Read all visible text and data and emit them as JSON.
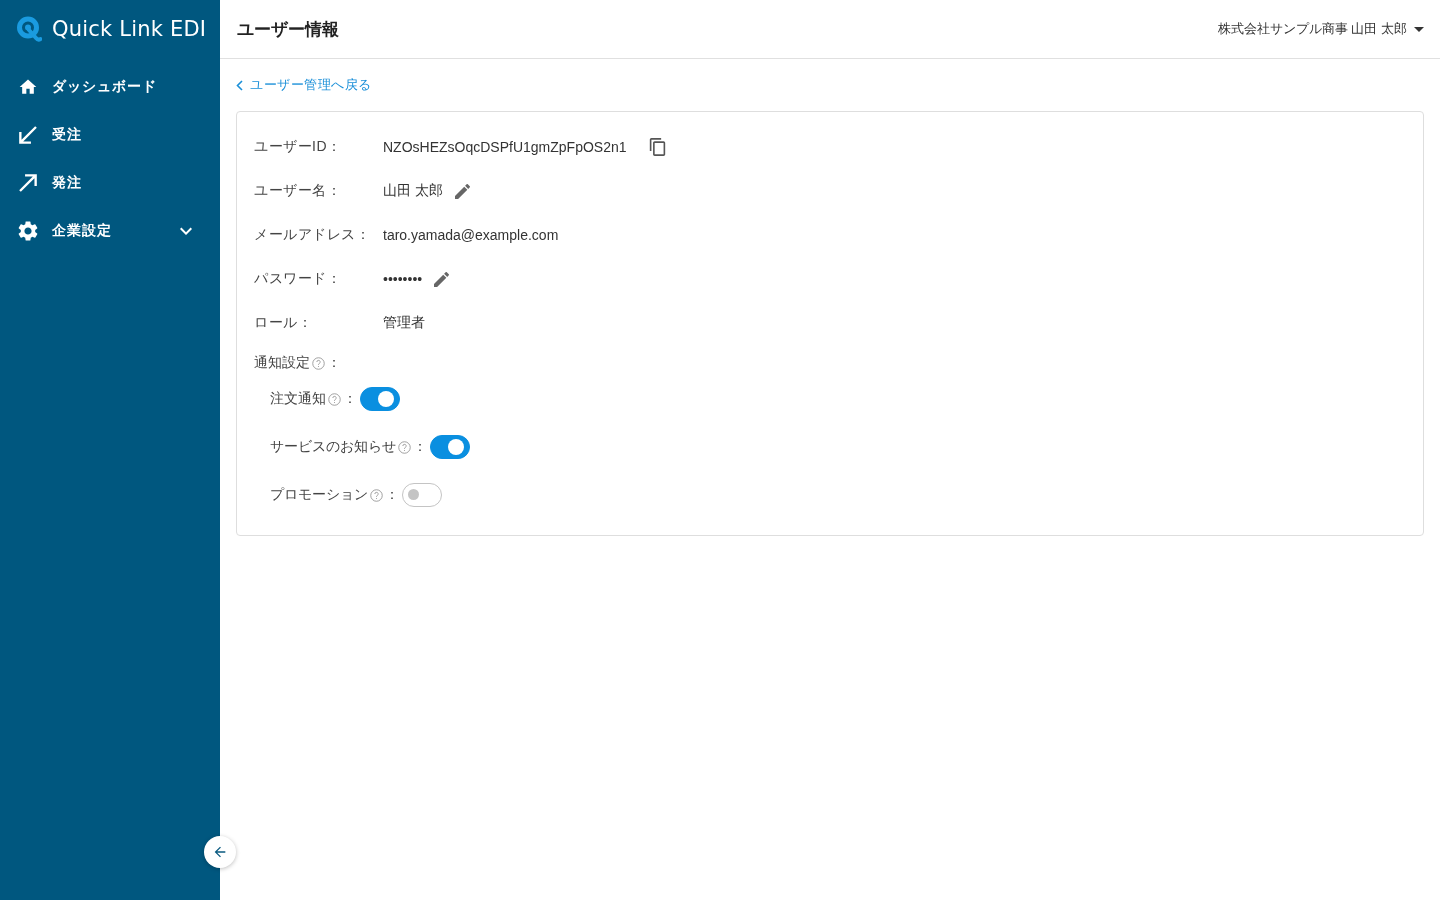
{
  "sidebar": {
    "logo": "Quick Link EDI",
    "items": [
      {
        "label": "ダッシュボード",
        "kind": "link"
      },
      {
        "label": "受注",
        "kind": "link"
      },
      {
        "label": "発注",
        "kind": "link"
      },
      {
        "label": "企業設定",
        "kind": "group",
        "expanded": false
      }
    ]
  },
  "header": {
    "title": "ユーザー情報",
    "account": "株式会社サンプル商事 山田 太郎"
  },
  "back_link": "ユーザー管理へ戻る",
  "profile": {
    "fields": [
      {
        "label": "ユーザーID：",
        "value": "NZOsHEZsOqcDSPfU1gmZpFpOS2n1",
        "kind": "copyable"
      },
      {
        "label": "ユーザー名：",
        "value": "山田 太郎",
        "kind": "editable"
      },
      {
        "label": "メールアドレス：",
        "value": "taro.yamada@example.com",
        "kind": "plain"
      },
      {
        "label": "パスワード：",
        "value": "••••••••",
        "kind": "editable"
      },
      {
        "label": "ロール：",
        "value": "管理者",
        "kind": "plain"
      }
    ],
    "notifications": {
      "label": "通知設定",
      "separator": "：",
      "items": [
        {
          "label": "注文通知",
          "separator": "：",
          "on": true
        },
        {
          "label": "サービスのお知らせ",
          "separator": "：",
          "on": true
        },
        {
          "label": "プロモーション",
          "separator": "：",
          "on": false
        }
      ]
    }
  }
}
